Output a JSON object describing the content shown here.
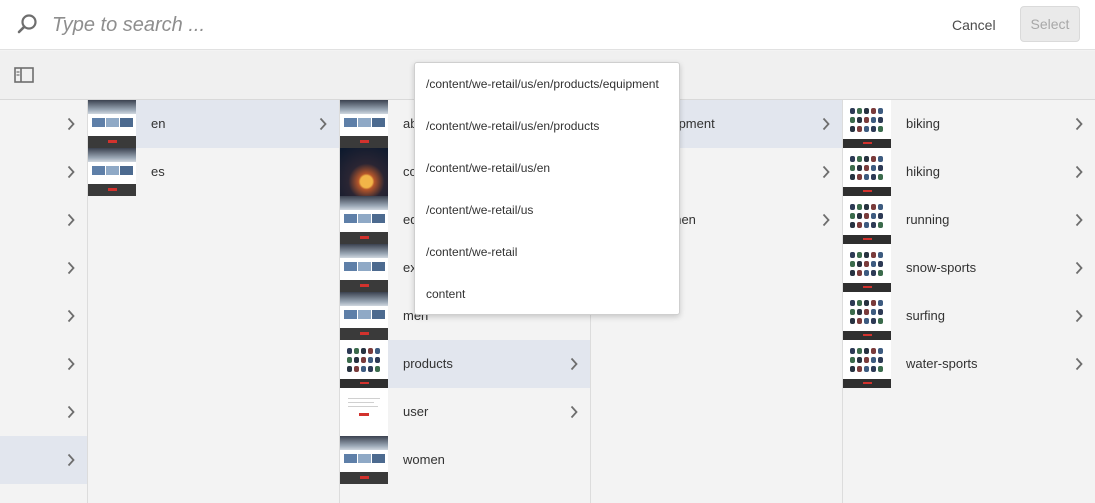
{
  "search": {
    "placeholder": "Type to search ..."
  },
  "buttons": {
    "cancel": "Cancel",
    "select": "Select"
  },
  "path_menu": [
    "/content/we-retail/us/en/products/equipment",
    "/content/we-retail/us/en/products",
    "/content/we-retail/us/en",
    "/content/we-retail/us",
    "/content/we-retail",
    "content"
  ],
  "columns": {
    "col1": [
      {
        "label": "en",
        "selected": true,
        "has_children": true,
        "thumb": "site"
      },
      {
        "label": "es",
        "selected": false,
        "has_children": false,
        "thumb": "site"
      }
    ],
    "col2": [
      {
        "label": "about-us",
        "selected": false,
        "has_children": true,
        "thumb": "site"
      },
      {
        "label": "community",
        "selected": false,
        "has_children": true,
        "thumb": "night"
      },
      {
        "label": "equipment",
        "selected": false,
        "has_children": true,
        "thumb": "site"
      },
      {
        "label": "experience",
        "selected": false,
        "has_children": true,
        "thumb": "site"
      },
      {
        "label": "men",
        "selected": false,
        "has_children": false,
        "thumb": "site"
      },
      {
        "label": "products",
        "selected": true,
        "has_children": true,
        "thumb": "prod"
      },
      {
        "label": "user",
        "selected": false,
        "has_children": true,
        "thumb": "user"
      },
      {
        "label": "women",
        "selected": false,
        "has_children": false,
        "thumb": "site"
      }
    ],
    "col3": [
      {
        "label": "equipment",
        "selected": true,
        "has_children": true
      },
      {
        "label": "",
        "selected": false,
        "has_children": true
      },
      {
        "label": "women",
        "selected": false,
        "has_children": true
      }
    ],
    "col4": [
      {
        "label": "biking",
        "selected": false,
        "has_children": true,
        "thumb": "prod"
      },
      {
        "label": "hiking",
        "selected": false,
        "has_children": true,
        "thumb": "prod"
      },
      {
        "label": "running",
        "selected": false,
        "has_children": true,
        "thumb": "prod"
      },
      {
        "label": "snow-sports",
        "selected": false,
        "has_children": true,
        "thumb": "prod"
      },
      {
        "label": "surfing",
        "selected": false,
        "has_children": true,
        "thumb": "prod"
      },
      {
        "label": "water-sports",
        "selected": false,
        "has_children": true,
        "thumb": "prod"
      }
    ]
  },
  "colors": {
    "selected_row": "#e2e6ee",
    "accent_red": "#d2322d"
  }
}
